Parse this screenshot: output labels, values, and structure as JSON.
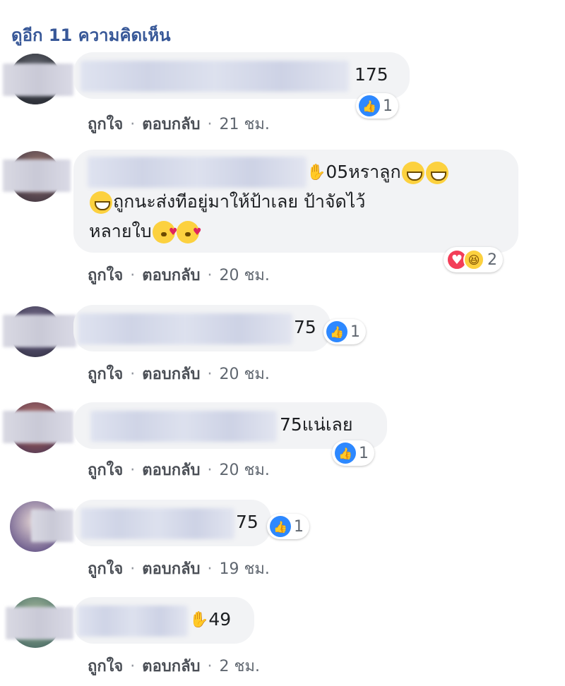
{
  "header": {
    "view_more": "ดูอีก 11 ความคิดเห็น"
  },
  "actions": {
    "like": "ถูกใจ",
    "reply": "ตอบกลับ"
  },
  "comments": [
    {
      "text": "175",
      "react_count": "1",
      "time": "21 ชม."
    },
    {
      "text_line1": "05หราลูก",
      "text_line2": "ถูกนะส่งทีอยู่มาให้ป้าเลย ป้าจัดไว้",
      "text_line3": "หลายใบ",
      "react_count": "2",
      "time": "20 ชม."
    },
    {
      "text": "75",
      "react_count": "1",
      "time": "20 ชม."
    },
    {
      "text": "75แน่เลย",
      "react_count": "1",
      "time": "20 ชม."
    },
    {
      "text": "75",
      "react_count": "1",
      "time": "19 ชม."
    },
    {
      "text": "49",
      "time": "2 ชม."
    }
  ],
  "icons": {
    "like": "like-icon",
    "love": "heart-icon",
    "haha": "haha-icon",
    "wave": "wave-icon",
    "grin": "grin-emoji",
    "kiss": "kiss-emoji"
  },
  "colors": {
    "link": "#385898",
    "bubble": "#f2f3f5",
    "like_blue": "#2d88ff",
    "love_red": "#f33e58"
  }
}
